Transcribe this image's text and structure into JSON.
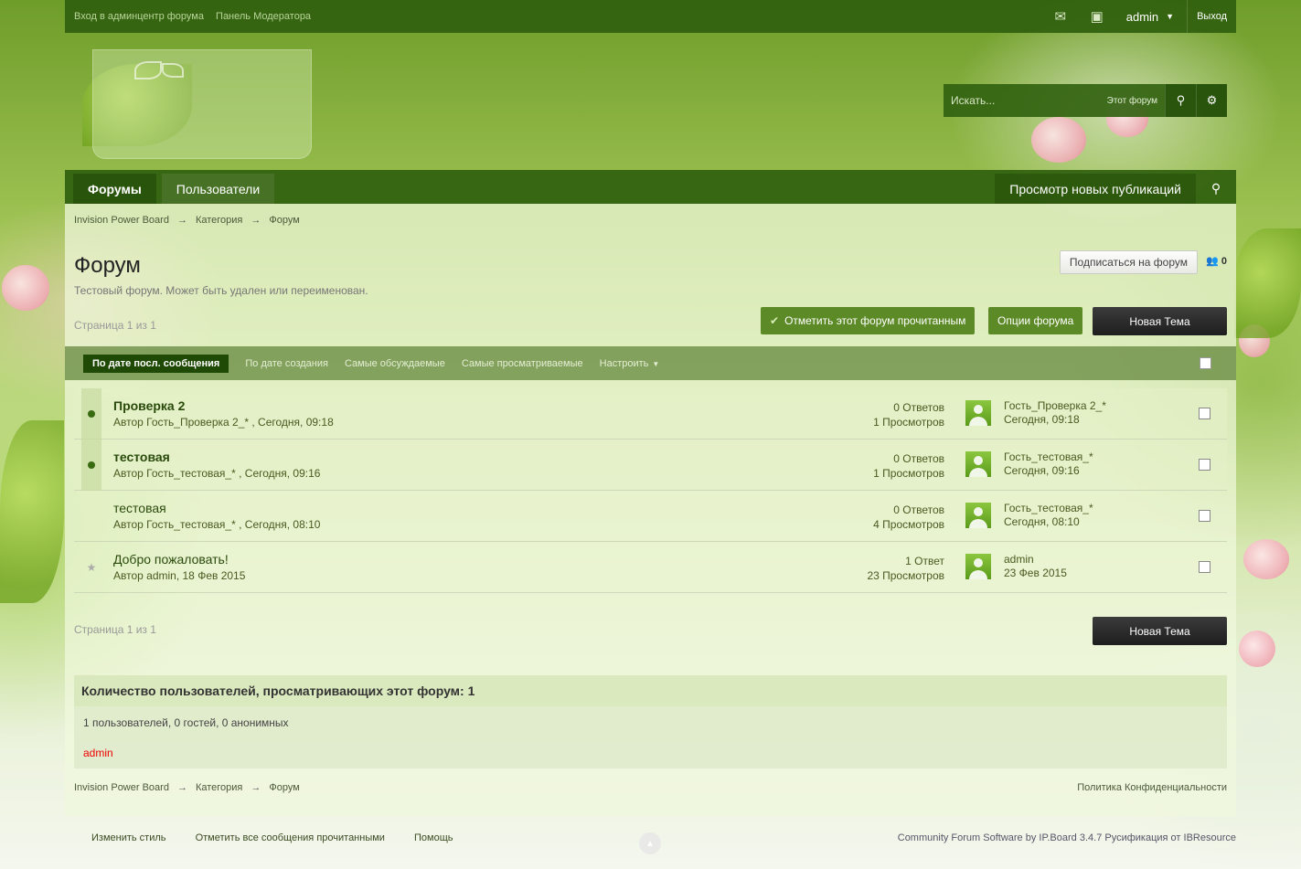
{
  "userbar": {
    "links": [
      "Вход в админцентр форума",
      "Панель Модератора"
    ],
    "username": "admin",
    "logout": "Выход",
    "icons": [
      "envelope-icon",
      "contact-card-icon",
      "chevron-down-icon"
    ]
  },
  "search": {
    "placeholder": "Искать...",
    "scope": "Этот форум",
    "icons": [
      "search-icon",
      "gear-icon"
    ]
  },
  "nav": {
    "tabs": [
      "Форумы",
      "Пользователи"
    ],
    "new_content": "Просмотр новых публикаций",
    "icons": [
      "location-pin-icon"
    ]
  },
  "breadcrumb": [
    "Invision Power Board",
    "Категория",
    "Форум"
  ],
  "forum": {
    "title": "Форум",
    "description": "Тестовый форум. Может быть удален или переименован.",
    "subscribe": "Подписаться на форум",
    "followers": "0"
  },
  "pagination": "Страница 1 из 1",
  "buttons": {
    "mark_read": "Отметить этот форум прочитанным",
    "options": "Опции форума",
    "new_topic": "Новая Тема"
  },
  "filters": [
    "По дате посл. сообщения",
    "По дате создания",
    "Самые обсуждаемые",
    "Самые просматриваемые",
    "Настроить"
  ],
  "topics": [
    {
      "title": "Проверка 2",
      "meta": "Автор Гость_Проверка 2_* , Сегодня, 09:18",
      "replies": "0 Ответов",
      "views": "1 Просмотров",
      "last_user": "Гость_Проверка 2_*",
      "last_date": "Сегодня, 09:18"
    },
    {
      "title": "тестовая",
      "meta": "Автор Гость_тестовая_* , Сегодня, 09:16",
      "replies": "0 Ответов",
      "views": "1 Просмотров",
      "last_user": "Гость_тестовая_*",
      "last_date": "Сегодня, 09:16"
    },
    {
      "title": "тестовая",
      "meta": "Автор Гость_тестовая_* , Сегодня, 08:10",
      "replies": "0 Ответов",
      "views": "4 Просмотров",
      "last_user": "Гость_тестовая_*",
      "last_date": "Сегодня, 08:10"
    },
    {
      "title": "Добро пожаловать!",
      "meta": "Автор admin, 18 Фев 2015",
      "replies": "1 Ответ",
      "views": "23 Просмотров",
      "last_user": "admin",
      "last_date": "23 Фев 2015"
    }
  ],
  "online": {
    "title": "Количество пользователей, просматривающих этот форум: 1",
    "counts": "1 пользователей, 0 гостей, 0 анонимных",
    "user": "admin",
    "user_color": "#e00000"
  },
  "privacy": "Политика Конфиденциальности",
  "footer": {
    "links": [
      "Изменить стиль",
      "Отметить все сообщения прочитанными",
      "Помощь"
    ],
    "copyright": "Community Forum Software by IP.Board 3.4.7 Русификация от IBResource"
  },
  "colors": {
    "accent": "#30600e",
    "button_green": "#5c8a26",
    "button_dark": "#1e1e1e"
  }
}
